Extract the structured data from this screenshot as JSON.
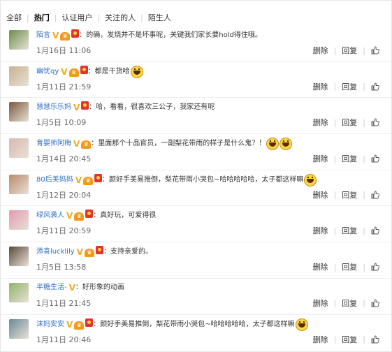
{
  "tabs": [
    {
      "label": "全部",
      "active": false
    },
    {
      "label": "热门",
      "active": true
    },
    {
      "label": "认证用户",
      "active": false
    },
    {
      "label": "关注的人",
      "active": false
    },
    {
      "label": "陌生人",
      "active": false
    }
  ],
  "actions": {
    "delete": "删除",
    "reply": "回复"
  },
  "comments": [
    {
      "user": "陌言",
      "badges": [
        "v",
        "vip",
        "hongbao"
      ],
      "text": "的确，发烧并不是坏事呢，关键我们家长要hold得住哦。",
      "emoji_count": 0,
      "time": "1月16日 11:06",
      "avatar_color": "#6a8f4a"
    },
    {
      "user": "幽忧qy",
      "badges": [
        "v",
        "vip",
        "hongbao"
      ],
      "text": "都是干货哈",
      "emoji_count": 1,
      "time": "1月11日 21:59",
      "avatar_color": "#c9b28e"
    },
    {
      "user": "慧慧乐乐妈",
      "badges": [
        "v",
        "hongbao"
      ],
      "text": "哈，看看，很喜欢三公子，我家还有呢",
      "emoji_count": 0,
      "time": "1月5日 10:09",
      "avatar_color": "#7a5a3c"
    },
    {
      "user": "育婴师阿梅",
      "badges": [
        "v",
        "vip"
      ],
      "text": "里面那个十品官员，一副梨花带雨的样子是什么鬼？！",
      "emoji_count": 2,
      "time": "1月14日 20:45",
      "avatar_color": "#d8b9b0"
    },
    {
      "user": "80后美妈妈",
      "badges": [
        "v",
        "vip",
        "hongbao"
      ],
      "text": "颜好手美易推倒，梨花带雨小哭包~哈哈哈哈哈，太子都这样嘛",
      "emoji_count": 1,
      "time": "1月12日 20:04",
      "avatar_color": "#b98a6a"
    },
    {
      "user": "绿风袭人",
      "badges": [
        "v",
        "vip",
        "hongbao"
      ],
      "text": "真好玩，可爱得很",
      "emoji_count": 0,
      "time": "1月11日 20:59",
      "avatar_color": "#e39ab0"
    },
    {
      "user": "添喜lucklily",
      "badges": [
        "v",
        "vip",
        "hongbao"
      ],
      "text": "支持亲爱的。",
      "emoji_count": 0,
      "time": "1月5日 13:58",
      "avatar_color": "#5a4a3a"
    },
    {
      "user": "半糖生活-",
      "badges": [
        "v"
      ],
      "text": "好形象的动画",
      "emoji_count": 0,
      "time": "1月11日 21:45",
      "avatar_color": "#8fb46a"
    },
    {
      "user": "沫妈安安",
      "badges": [
        "v",
        "vip",
        "hongbao"
      ],
      "text": "颜好手美易推倒，梨花带雨小哭包~哈哈哈哈哈，太子都这样嘛",
      "emoji_count": 1,
      "time": "1月11日 20:46",
      "avatar_color": "#6a8a9a"
    }
  ]
}
